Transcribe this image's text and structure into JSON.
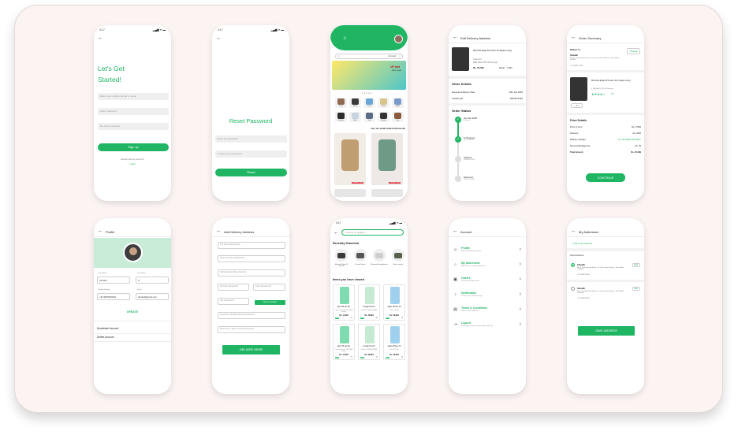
{
  "status": {
    "time": "4:17",
    "icons": "▂▄▆ ≋ ▬"
  },
  "login": {
    "title1": "Let's Get",
    "title2": "Started!",
    "ph_user": "Enter your mobile number or email",
    "ph_pass": "Enter Password",
    "ph_confirm": "Re-enter password",
    "button": "Sign up",
    "already": "Already have an account?",
    "login_link": "Login"
  },
  "reset": {
    "title": "Reset Password",
    "ph_new": "Enter the password",
    "ph_confirm": "Confirm new password",
    "button": "Reset"
  },
  "home": {
    "location": "Around",
    "promo_title": "UP and",
    "promo_sub": "easy to get",
    "section": "very cut steals babrommmoosah",
    "products": [
      "Jacket",
      "Watch",
      "Phone",
      "Shoes",
      "Mobile",
      "Earbuds",
      "Bottle",
      "Sofa",
      "Speaker",
      "Bag"
    ],
    "tags": [
      "Limited Deals",
      "Limited Deals"
    ]
  },
  "edit_delivery": {
    "header": "Edit Delivery Address",
    "product": "Motorola Edge 50 Fusion Pro(Space Grey)",
    "color": "Coloured",
    "storage": "8GB RAM 256 GB Storage",
    "price": "Rs. 25,099",
    "mode": "Mode :- COD",
    "other_title": "Other Details",
    "edd_label": "Expected Delivery Date",
    "edd_value": "10th Jan 2025",
    "tracking_label": "Tracking ID",
    "tracking_value": "TRK4573120",
    "status_title": "Order Status",
    "steps": [
      {
        "title": "2nd Jan 2025",
        "sub": "4:45 pm"
      },
      {
        "title": "In Progress",
        "sub": "8th Jan 2025"
      },
      {
        "title": "Shipped",
        "sub": "10th Jan 2025"
      },
      {
        "title": "Delivered",
        "sub": "10th Jan 2025"
      }
    ]
  },
  "summary": {
    "header": "Order Summary",
    "deliver_to": "Deliver to:",
    "change": "Change",
    "name": "Simadh",
    "address": "No. 8, Vivekananda Street, 1st Cross Street Kovern, Tamil Nadu - 600096",
    "phone": "+91 9988776655",
    "product": "Motorola Edge 50 Fusion Pro (Space Grey)",
    "storage": "8 GB RAM | 256 GB Storage",
    "rating": "★★★★☆",
    "rating_val": "4.8",
    "qty": "1",
    "price_title": "Price Details",
    "rows": [
      [
        "Price (1 item)",
        "Rs. 27999"
      ],
      [
        "Discount",
        "- Rs. 2000"
      ],
      [
        "Delivery Charges",
        "Rs. 40  FREE DELIVERY"
      ],
      [
        "Secured Package Fee",
        "Rs. 49"
      ],
      [
        "Total Amount",
        "Rs. 25,099"
      ]
    ],
    "button": "CONTINUE"
  },
  "profile": {
    "header": "Profile",
    "fn_label": "First Name",
    "fn": "Simadh",
    "ln_label": "Last Name",
    "ln": "S",
    "mobile_label": "Mobile Number",
    "mobile": "+91 9876543210",
    "email_label": "Email",
    "email": "abcdef@gmail.com",
    "update": "UPDATE",
    "deactivate": "Deactivate Account",
    "delete": "Delete Account"
  },
  "add_delivery": {
    "header": "Add Delivery Address",
    "fields": [
      "Full Name (Required)*",
      "Phone Number (Required)*",
      "Add alternate Phone Number",
      "Pincode (Required)*",
      "State (Required)*",
      "City (Required)*",
      "House No, Building Name (Required)*",
      "Road name, Area, Colony (Required)*"
    ],
    "location_btn": "Use my Location",
    "button": "DELIVER HERE"
  },
  "search": {
    "placeholder": "Looking for gadgets ...",
    "recent_title": "Recently Searched",
    "recent": [
      "Motorola Edge 50 Fusion",
      "Casual Shoes",
      "Bluetooth Headphones",
      "Men's jackets"
    ],
    "viewed_title": "Items you have viewed",
    "items": [
      {
        "name": "iQoo Z9 Lite 5G",
        "sub": "Coloured Green | 6GB 128GB Storage",
        "price": "Rs. 10,499"
      },
      {
        "name": "Google Pixel 9",
        "sub": "Obsidian 128GB 8GB RAM",
        "price": "Rs. 49,999"
      },
      {
        "name": "Apple iPhone 15",
        "sub": "Black, 128 GB",
        "price": "Rs. 69,999"
      },
      {
        "name": "iQoo Z9 Lite 5G",
        "sub": "Coloured Green | 6GB 128GB Storage",
        "price": "Rs. 10,499"
      },
      {
        "name": "Google Pixel 9",
        "sub": "Obsidian 128GB 8GB RAM",
        "price": "Rs. 49,999"
      },
      {
        "name": "Apple iPhone 15",
        "sub": "Black, 128 GB",
        "price": "Rs. 69,999"
      }
    ],
    "cart": "Add"
  },
  "account": {
    "header": "Account",
    "items": [
      {
        "title": "Profile",
        "sub": "Edit / manage your profile"
      },
      {
        "title": "My Addresses",
        "sub": "Add, edit your saved addresses"
      },
      {
        "title": "Orders",
        "sub": "Check your order status"
      },
      {
        "title": "Notification",
        "sub": "Check your notification logs"
      },
      {
        "title": "Terms & Conditions",
        "sub": "Policies and conditions"
      },
      {
        "title": "Logout",
        "sub": "Once logout, have to login again with otp"
      }
    ]
  },
  "addresses": {
    "header": "My Addresses",
    "add_new": "+  Add a new address",
    "saved": "Saved Address",
    "list": [
      {
        "name": "Simadh",
        "address": "No. 8, Vivekananda Street, 1st Cross Street Kovern, Tamil Nadu - 600096",
        "phone": "+91 9988776655",
        "edit": "Edit"
      },
      {
        "name": "Simadh",
        "address": "No. 7, Vivekananda Street, 1st Cross Street Kovern, Tamil Nadu - 600096",
        "phone": "+91 9988776655",
        "edit": "Edit"
      }
    ],
    "button": "SAVE ADDRESS"
  },
  "colors": {
    "brand": "#1fb563",
    "mint": "#c8ecd8",
    "canvas": "#fbf4f3"
  }
}
